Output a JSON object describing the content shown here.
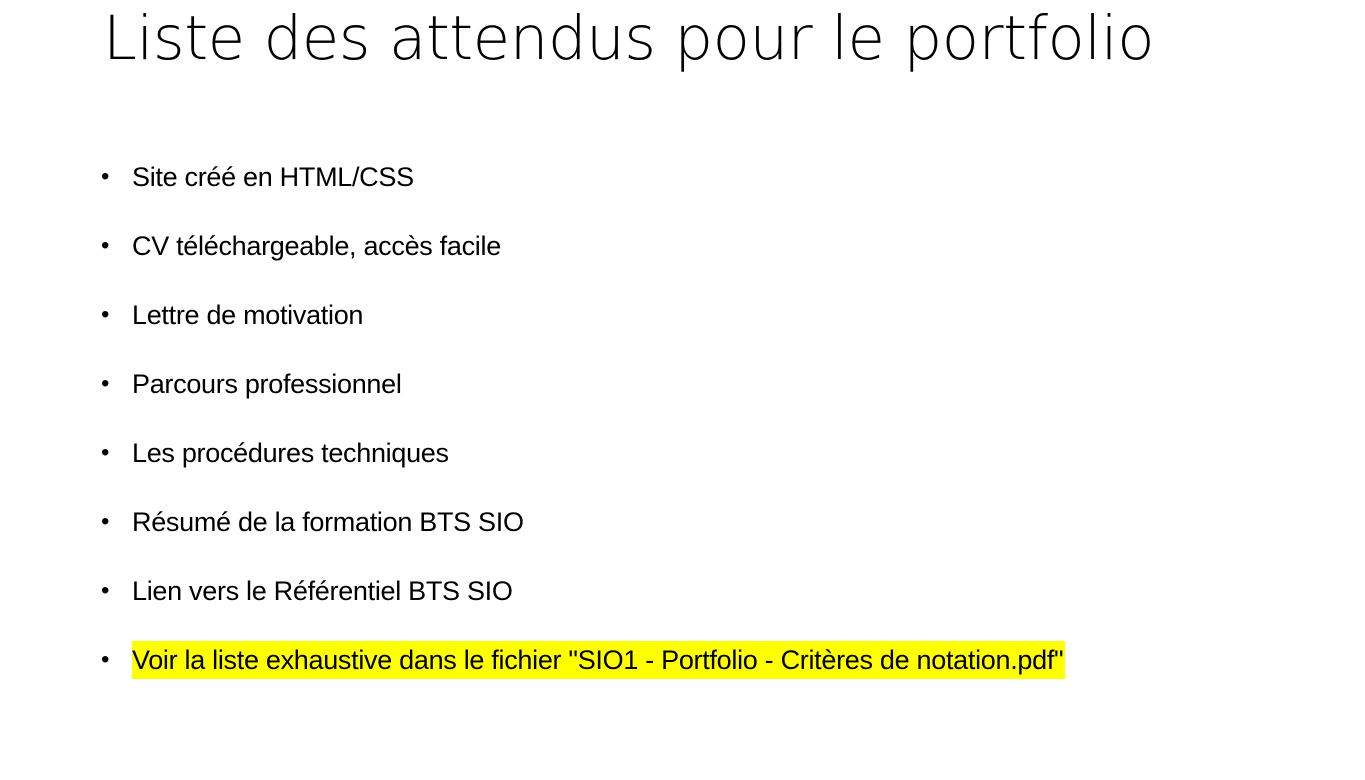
{
  "slide": {
    "title": "Liste des attendus pour le portfolio",
    "bullet_symbol": "•",
    "items": [
      {
        "text": "Site créé en HTML/CSS",
        "highlighted": false
      },
      {
        "text": "CV téléchargeable, accès facile",
        "highlighted": false
      },
      {
        "text": "Lettre de motivation",
        "highlighted": false
      },
      {
        "text": "Parcours professionnel",
        "highlighted": false
      },
      {
        "text": "Les procédures techniques",
        "highlighted": false
      },
      {
        "text": "Résumé de la formation BTS SIO",
        "highlighted": false
      },
      {
        "text": "Lien vers le Référentiel BTS SIO",
        "highlighted": false
      },
      {
        "text": "Voir la liste exhaustive dans le fichier \"SIO1 - Portfolio - Critères de notation.pdf\"",
        "highlighted": true
      }
    ],
    "colors": {
      "background": "#ffffff",
      "text": "#000000",
      "highlight": "#ffff00"
    }
  }
}
